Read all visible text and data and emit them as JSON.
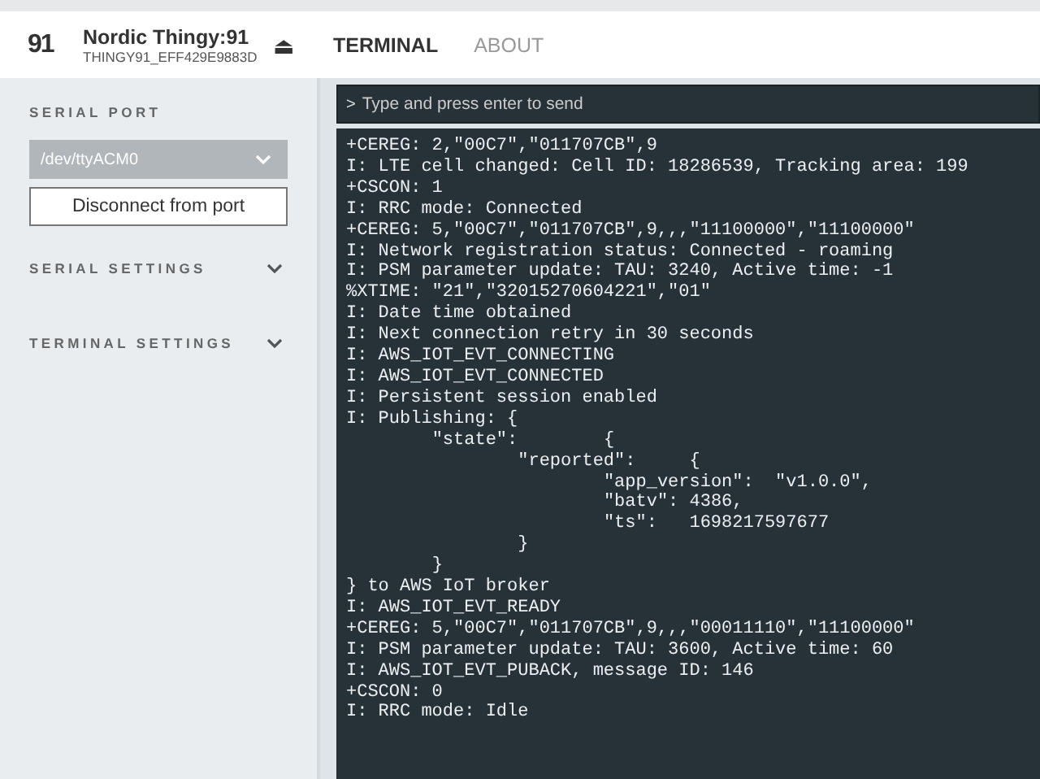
{
  "header": {
    "logo_text": "91",
    "device_name": "Nordic Thingy:91",
    "device_id": "THINGY91_EFF429E9883D",
    "eject_icon": "⏏",
    "tabs": [
      {
        "label": "TERMINAL",
        "selected": true
      },
      {
        "label": "ABOUT",
        "selected": false
      }
    ]
  },
  "sidebar": {
    "serial_port": {
      "heading": "SERIAL PORT",
      "port": "/dev/ttyACM0",
      "button": "Disconnect from port"
    },
    "sections": [
      {
        "label": "SERIAL SETTINGS",
        "expanded": false
      },
      {
        "label": "TERMINAL SETTINGS",
        "expanded": false
      }
    ]
  },
  "terminal": {
    "prompt": ">",
    "placeholder": "Type and press enter to send",
    "lines": [
      "+CEREG: 2,\"00C7\",\"011707CB\",9",
      "I: LTE cell changed: Cell ID: 18286539, Tracking area: 199",
      "+CSCON: 1",
      "I: RRC mode: Connected",
      "+CEREG: 5,\"00C7\",\"011707CB\",9,,,\"11100000\",\"11100000\"",
      "I: Network registration status: Connected - roaming",
      "I: PSM parameter update: TAU: 3240, Active time: -1",
      "%XTIME: \"21\",\"32015270604221\",\"01\"",
      "I: Date time obtained",
      "I: Next connection retry in 30 seconds",
      "I: AWS_IOT_EVT_CONNECTING",
      "I: AWS_IOT_EVT_CONNECTED",
      "I: Persistent session enabled",
      "I: Publishing: {",
      "\t\"state\":\t{",
      "\t\t\"reported\":\t{",
      "\t\t\t\"app_version\":\t\"v1.0.0\",",
      "\t\t\t\"batv\": 4386,",
      "\t\t\t\"ts\":\t1698217597677",
      "\t\t}",
      "\t}",
      "} to AWS IoT broker",
      "I: AWS_IOT_EVT_READY",
      "+CEREG: 5,\"00C7\",\"011707CB\",9,,,\"00011110\",\"11100000\"",
      "I: PSM parameter update: TAU: 3600, Active time: 60",
      "I: AWS_IOT_EVT_PUBACK, message ID: 146",
      "+CSCON: 0",
      "I: RRC mode: Idle"
    ]
  }
}
